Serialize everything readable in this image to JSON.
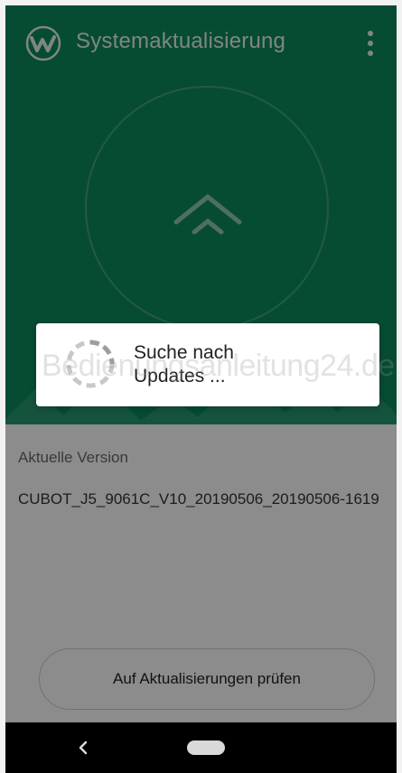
{
  "app_bar": {
    "title": "Systemaktualisierung",
    "logo_icon": "wave-logo-icon",
    "menu_icon": "overflow-menu-icon"
  },
  "hero": {
    "icon": "chevron-up-icon"
  },
  "version": {
    "label": "Aktuelle Version",
    "value": "CUBOT_J5_9061C_V10_20190506_20190506-1619"
  },
  "check_button": {
    "label": "Auf Aktualisierungen prüfen"
  },
  "progress_dialog": {
    "line1": "Suche nach",
    "line2": "Updates ...",
    "icon": "loading-spinner-icon"
  },
  "watermark": {
    "text": "Bedienungsanleitung24.de"
  },
  "nav_bar": {
    "back_icon": "back-icon",
    "home_icon": "home-pill-icon"
  },
  "colors": {
    "primary": "#0b8a5c",
    "scrim": "rgba(0,0,0,0.45)"
  }
}
